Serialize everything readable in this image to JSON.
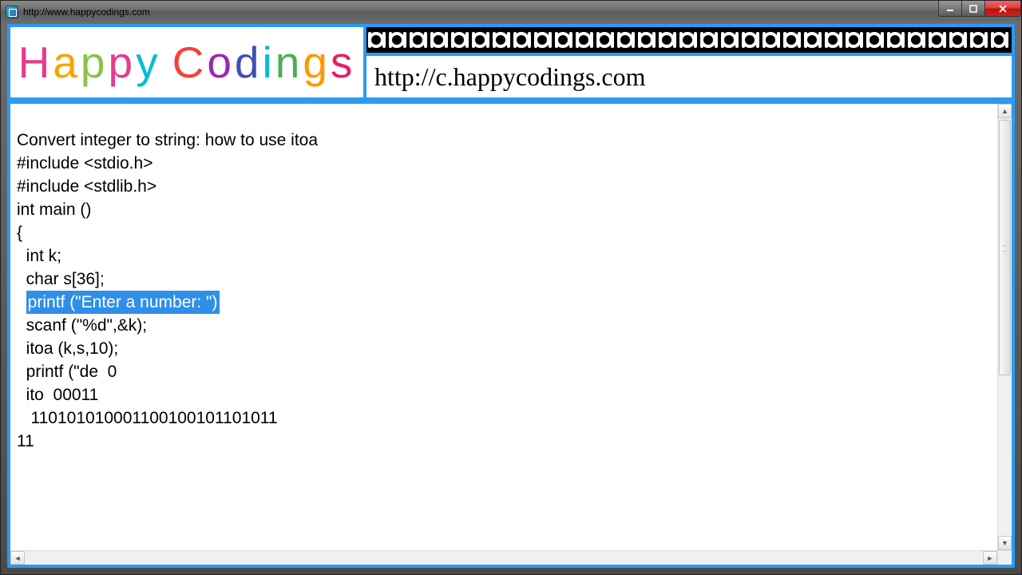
{
  "window": {
    "title": "http://www.happycodings.com"
  },
  "header": {
    "logo_letters": [
      "H",
      "a",
      "p",
      "p",
      "y",
      "C",
      "o",
      "d",
      "i",
      "n",
      "g",
      "s"
    ],
    "url_text": "http://c.happycodings.com"
  },
  "code": {
    "title_line": "Convert integer to string: how to use itoa",
    "lines_before": [
      "",
      "#include <stdio.h>",
      "#include <stdlib.h>",
      "",
      "int main ()",
      "{",
      "  int k;",
      "  char s[36];",
      ""
    ],
    "highlight_prefix": "  ",
    "highlight_text": "printf (\"Enter a number: \")",
    "lines_after": [
      "  scanf (\"%d\",&k);",
      "",
      "  itoa (k,s,10);",
      "  printf (\"de  0",
      "",
      "  ito  00011",
      "   110101010001100100101101011",
      "11"
    ]
  }
}
